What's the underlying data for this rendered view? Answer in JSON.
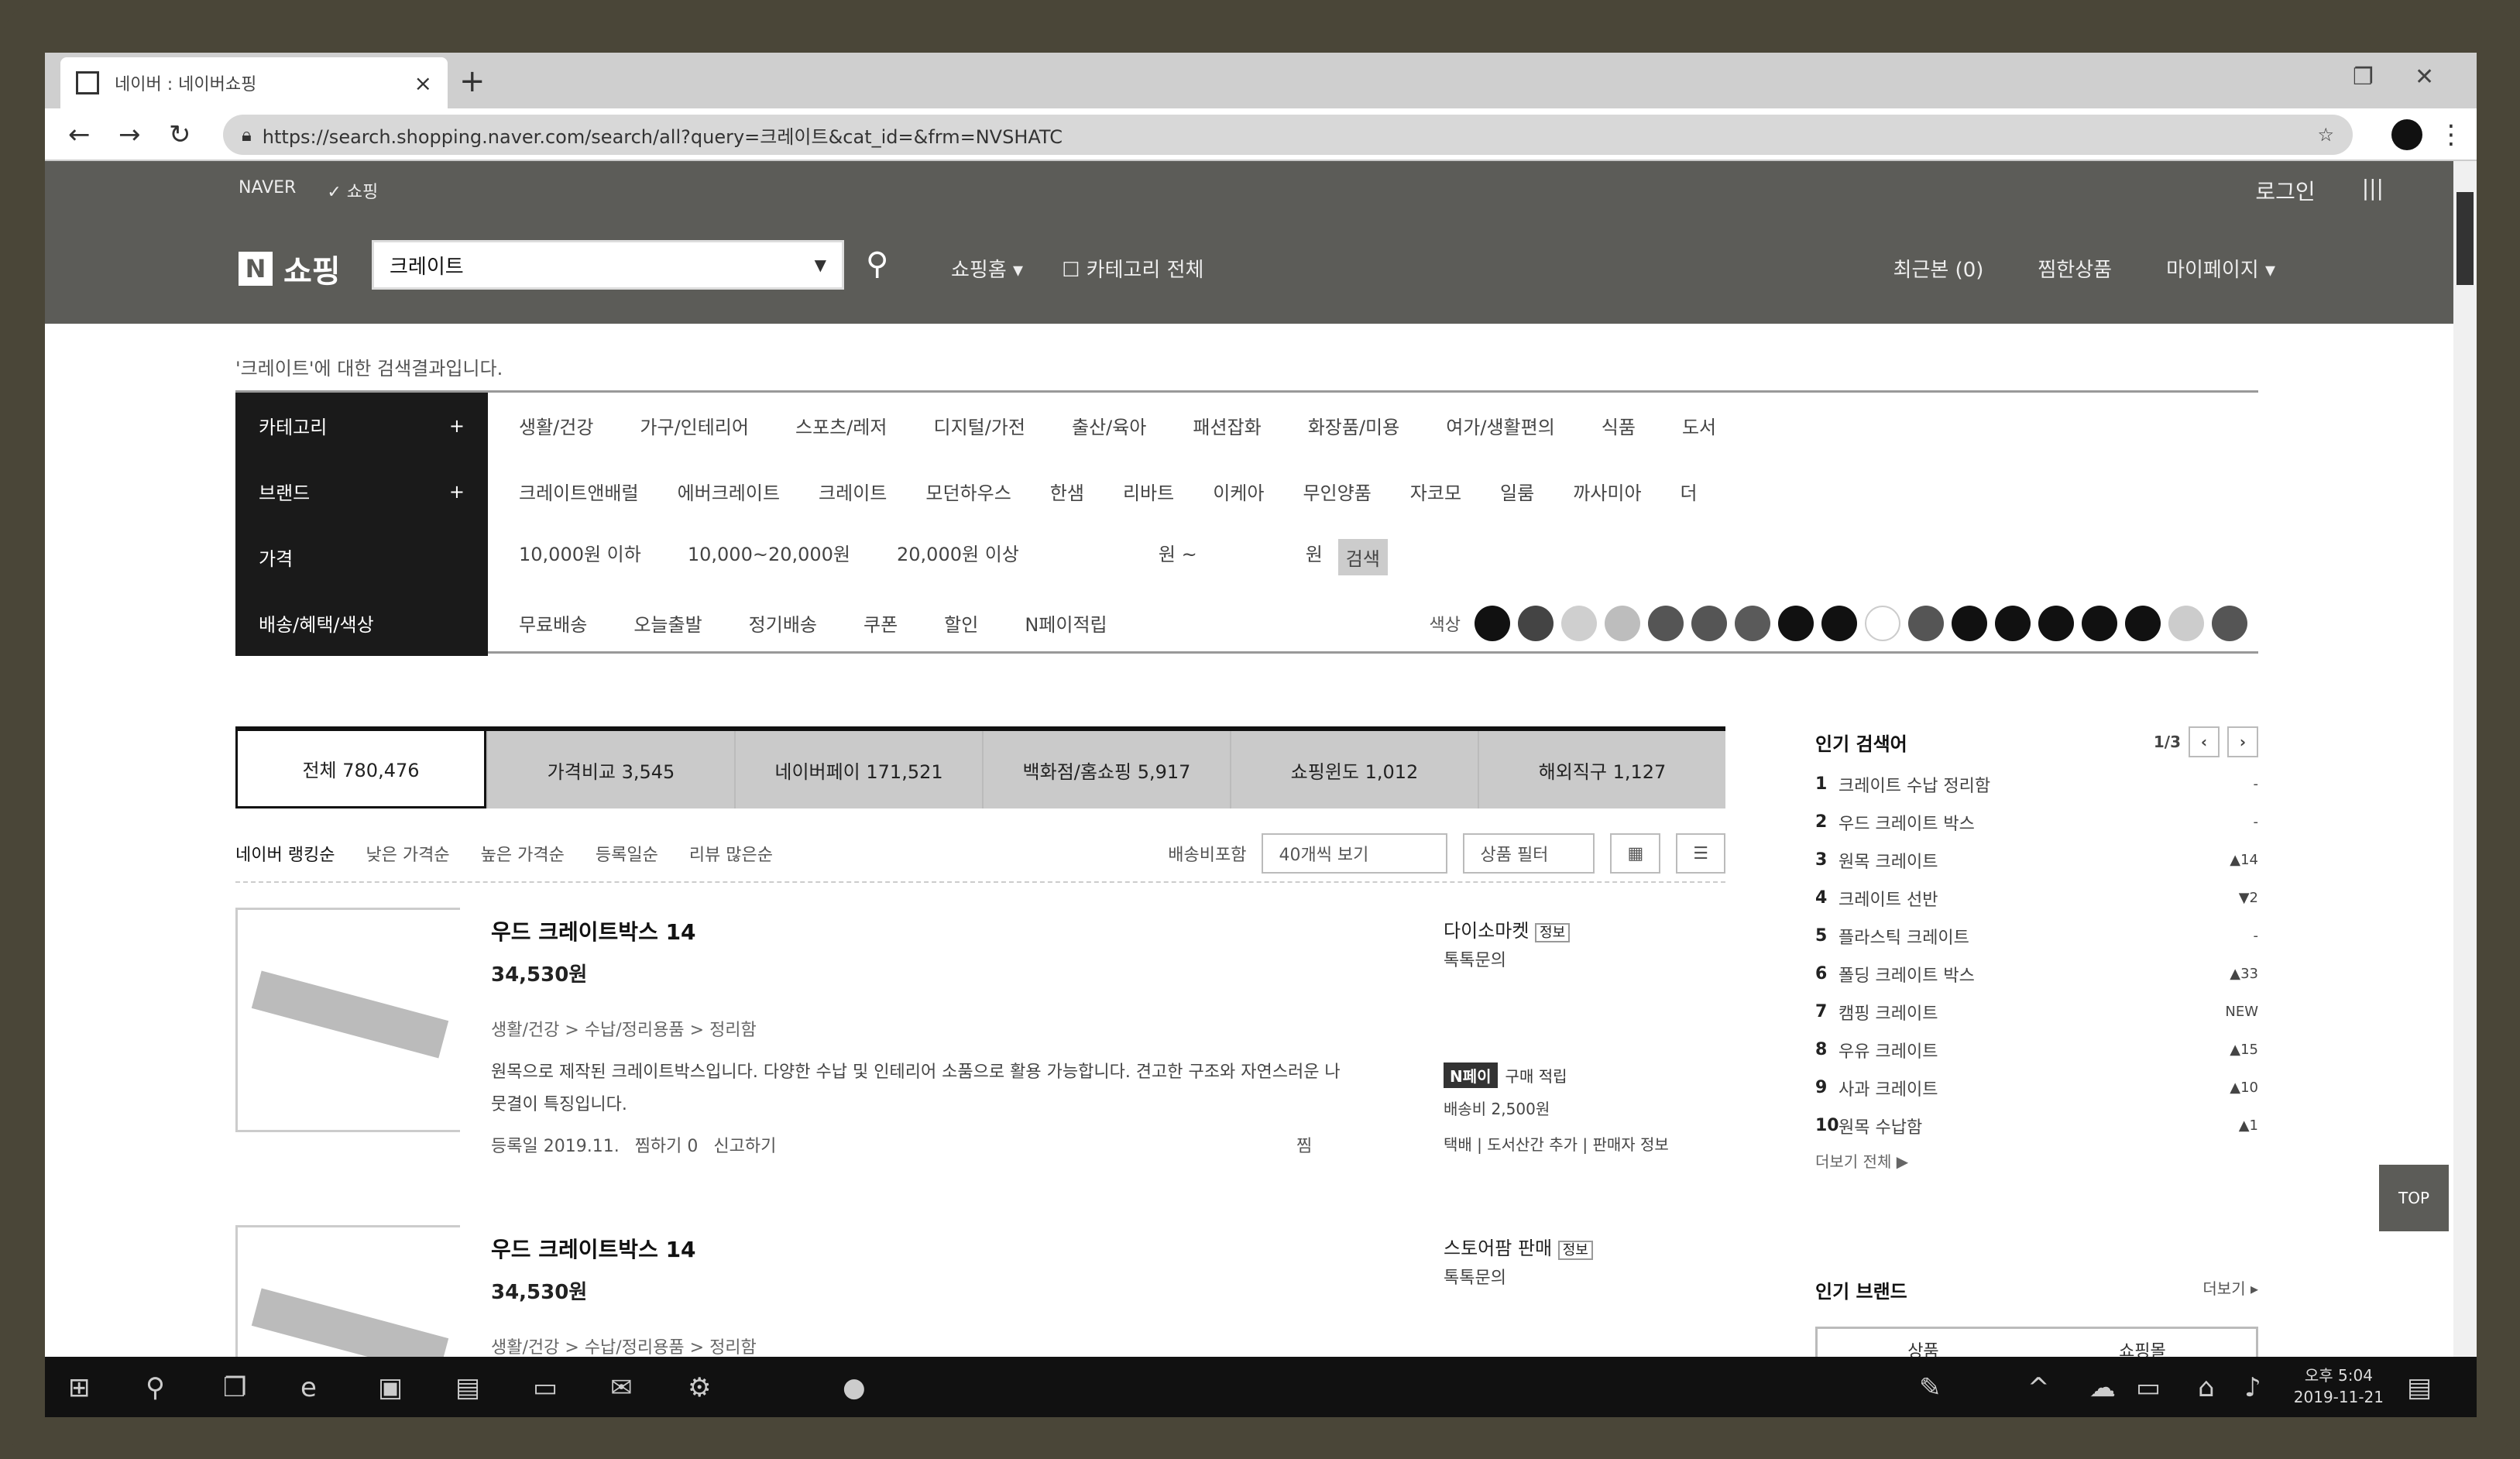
{
  "browser": {
    "tab_title": "네이버 : 네이버쇼핑",
    "url": "https://search.shopping.naver.com/search/all?query=크레이트&cat_id=&frm=NVSHATC"
  },
  "gnb": {
    "brand_links": [
      "NAVER",
      "✓ 쇼핑"
    ],
    "top_right": [
      "로그인",
      "|||"
    ],
    "logo_text": "쇼핑",
    "search_value": "크레이트",
    "menu": [
      "쇼핑홈 ▾",
      "☐ 카테고리 전체"
    ],
    "right_menu": [
      "최근본 (0)",
      "찜한상품",
      "마이페이지 ▾"
    ]
  },
  "notice": "'크레이트'에 대한 검색결과입니다.",
  "filter": {
    "rows": [
      {
        "label": "카테고리",
        "plus": "+",
        "values": [
          "생활/건강",
          "가구/인테리어",
          "스포츠/레저",
          "디지털/가전",
          "출산/육아",
          "패션잡화",
          "화장품/미용",
          "여가/생활편의",
          "식품",
          "도서"
        ]
      },
      {
        "label": "브랜드",
        "plus": "+",
        "values": [
          "크레이트앤배럴",
          "에버크레이트",
          "크레이트",
          "모던하우스",
          "한샘",
          "리바트",
          "이케아",
          "무인양품",
          "자코모",
          "일룸",
          "까사미아",
          "더"
        ]
      },
      {
        "label": "가격",
        "plus": "",
        "values": [
          "10,000원 이하",
          "10,000~20,000원",
          "20,000원 이상",
          "원 ~",
          "원",
          "검색"
        ]
      },
      {
        "label": "배송/혜택/색상",
        "plus": "",
        "values": [
          "무료배송",
          "오늘출발",
          "정기배송",
          "쿠폰",
          "할인",
          "N페이적립"
        ]
      }
    ],
    "color_label": "색상",
    "colors": [
      "#111111",
      "#444444",
      "#cfcfcf",
      "#bdbdbd",
      "#555555",
      "#555555",
      "#5a5a5a",
      "#111111",
      "#111111",
      "#ffffff",
      "#555555",
      "#111111",
      "#111111",
      "#111111",
      "#111111",
      "#111111",
      "#cccccc",
      "#555555"
    ]
  },
  "tabs": [
    "전체 780,476",
    "가격비교 3,545",
    "네이버페이 171,521",
    "백화점/홈쇼핑 5,917",
    "쇼핑윈도 1,012",
    "해외직구 1,127"
  ],
  "sort": {
    "options": [
      "네이버 랭킹순",
      "낮은 가격순",
      "높은 가격순",
      "등록일순",
      "리뷰 많은순"
    ],
    "right_label": "배송비포함",
    "select1": "40개씩 보기",
    "select2": "상품 필터",
    "view_list": "☰",
    "view_grid": "▦"
  },
  "products": [
    {
      "title": "우드 크레이트박스 14",
      "price": "34,530원",
      "category": "생활/건강 > 수납/정리용품 > 정리함",
      "desc": "원목으로 제작된 크레이트박스입니다. 다양한 수납 및 인테리어 소품으로 활용 가능합니다. 견고한 구조와 자연스러운 나뭇결이 특징입니다.",
      "meta": [
        "등록일 2019.11.",
        "찜하기 0",
        "신고하기"
      ],
      "zzim": "찜",
      "mall": "다이소마켓",
      "mall_tag": "정보",
      "mall2": "톡톡문의",
      "badge": "N페이",
      "badge_text": "구매 적립",
      "ship": "배송비 2,500원",
      "ship2": "택배 | 도서산간 추가 | 판매자 정보"
    },
    {
      "title": "우드 크레이트박스 14",
      "price": "34,530원",
      "category": "생활/건강 > 수납/정리용품 > 정리함",
      "mall": "스토어팜 판매",
      "mall_tag": "정보",
      "mall2": "톡톡문의"
    }
  ],
  "popular": {
    "title": "인기 검색어",
    "page": "1/3",
    "items": [
      {
        "num": "1",
        "text": "크레이트 수납 정리함",
        "chg": "-"
      },
      {
        "num": "2",
        "text": "우드 크레이트 박스",
        "chg": "-"
      },
      {
        "num": "3",
        "text": "원목 크레이트",
        "chg": "▲14"
      },
      {
        "num": "4",
        "text": "크레이트 선반",
        "chg": "▼2"
      },
      {
        "num": "5",
        "text": "플라스틱 크레이트",
        "chg": "-"
      },
      {
        "num": "6",
        "text": "폴딩 크레이트 박스",
        "chg": "▲33"
      },
      {
        "num": "7",
        "text": "캠핑 크레이트",
        "chg": "NEW"
      },
      {
        "num": "8",
        "text": "우유 크레이트",
        "chg": "▲15"
      },
      {
        "num": "9",
        "text": "사과 크레이트",
        "chg": "▲10"
      },
      {
        "num": "10",
        "text": "원목 수납함",
        "chg": "▲1"
      }
    ],
    "more": "더보기 전체 ▶"
  },
  "side2": {
    "title": "인기 브랜드",
    "more": "더보기 ▸",
    "tabs": [
      "상품",
      "쇼핑몰"
    ]
  },
  "top_button": "TOP",
  "clock": {
    "time": "오후 5:04",
    "date": "2019-11-21"
  }
}
